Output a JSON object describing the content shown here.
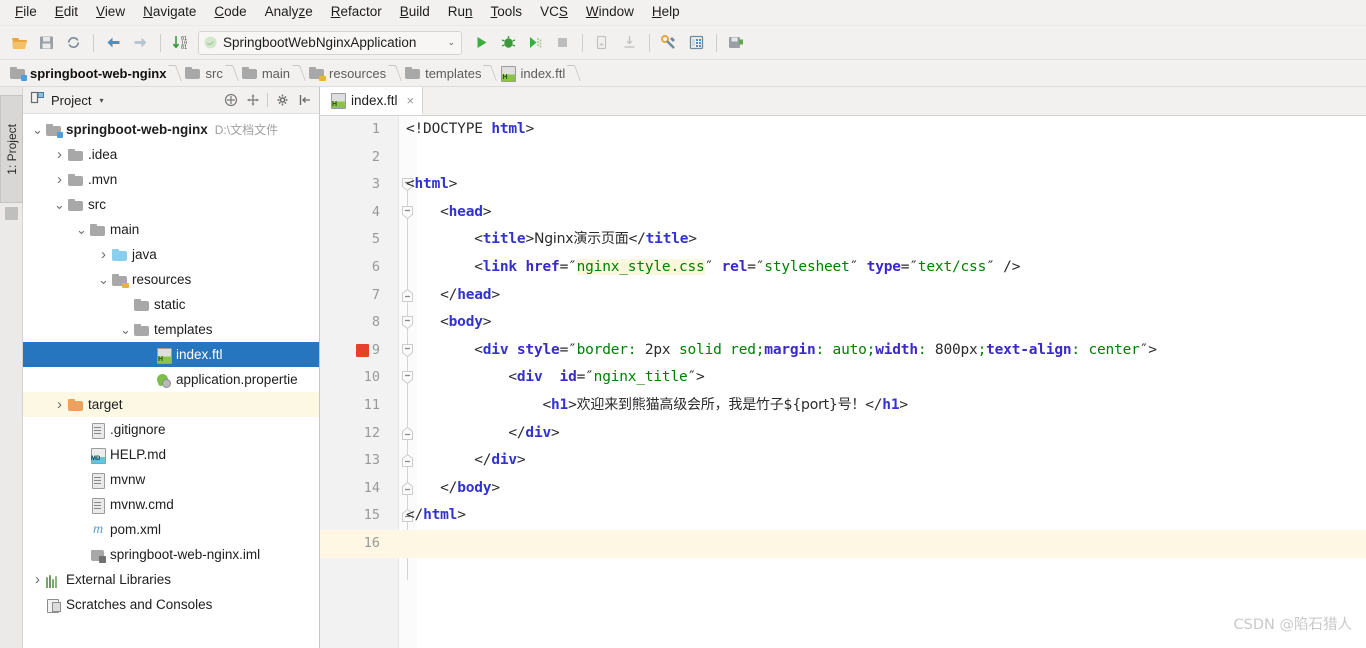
{
  "menubar": {
    "items": [
      {
        "label": "File",
        "mnemonic": "F"
      },
      {
        "label": "Edit",
        "mnemonic": "E"
      },
      {
        "label": "View",
        "mnemonic": "V"
      },
      {
        "label": "Navigate",
        "mnemonic": "N"
      },
      {
        "label": "Code",
        "mnemonic": "C"
      },
      {
        "label": "Analyze",
        "mnemonic": "z"
      },
      {
        "label": "Refactor",
        "mnemonic": "R"
      },
      {
        "label": "Build",
        "mnemonic": "B"
      },
      {
        "label": "Run",
        "mnemonic": "n"
      },
      {
        "label": "Tools",
        "mnemonic": "T"
      },
      {
        "label": "VCS",
        "mnemonic": "S"
      },
      {
        "label": "Window",
        "mnemonic": "W"
      },
      {
        "label": "Help",
        "mnemonic": "H"
      }
    ]
  },
  "toolbar": {
    "left_icons": [
      "open-folder-icon",
      "save-all-icon",
      "sync-icon"
    ],
    "nav_icons": [
      "back-arrow-icon",
      "forward-arrow-icon"
    ],
    "sort_icon": "sort-numeric-icon",
    "run_config": {
      "name": "SpringbootWebNginxApplication",
      "icon": "spring-boot-icon",
      "arrow": "⌄"
    },
    "right_icons": [
      "run-icon",
      "debug-icon",
      "run-with-coverage-icon",
      "stop-icon",
      "attach-profiler-icon",
      "attach-debugger-icon",
      "settings-wrench-icon",
      "database-icon",
      "save-deploy-icon"
    ]
  },
  "breadcrumb": {
    "items": [
      {
        "label": "springboot-web-nginx",
        "icon": "module-folder-icon"
      },
      {
        "label": "src",
        "icon": "folder-icon"
      },
      {
        "label": "main",
        "icon": "folder-icon"
      },
      {
        "label": "resources",
        "icon": "resources-folder-icon"
      },
      {
        "label": "templates",
        "icon": "folder-icon"
      },
      {
        "label": "index.ftl",
        "icon": "ftl-file-icon"
      }
    ]
  },
  "left_strip": {
    "project_tab": "1: Project",
    "structure_icon": "structure-icon"
  },
  "project_panel": {
    "title": "Project",
    "title_icon": "project-view-icon",
    "caret": "▾",
    "actions": [
      {
        "name": "collapse-all-icon"
      },
      {
        "name": "scroll-from-source-icon"
      },
      {
        "name": "settings-gear-icon"
      },
      {
        "name": "hide-panel-icon"
      }
    ],
    "tree": [
      {
        "label": "springboot-web-nginx",
        "path": "D:\\文档文件",
        "indent": 0,
        "arrow": "expanded",
        "icon": "module-folder-icon",
        "bold": true,
        "state": "normal"
      },
      {
        "label": ".idea",
        "indent": 1,
        "arrow": "collapsed",
        "icon": "folder-icon",
        "state": "normal"
      },
      {
        "label": ".mvn",
        "indent": 1,
        "arrow": "collapsed",
        "icon": "folder-icon",
        "state": "normal"
      },
      {
        "label": "src",
        "indent": 1,
        "arrow": "expanded",
        "icon": "folder-icon",
        "state": "normal"
      },
      {
        "label": "main",
        "indent": 2,
        "arrow": "expanded",
        "icon": "folder-icon",
        "state": "normal"
      },
      {
        "label": "java",
        "indent": 3,
        "arrow": "collapsed",
        "icon": "sources-folder-icon",
        "state": "normal"
      },
      {
        "label": "resources",
        "indent": 3,
        "arrow": "expanded",
        "icon": "resources-folder-icon",
        "state": "normal"
      },
      {
        "label": "static",
        "indent": 4,
        "arrow": "none",
        "icon": "folder-icon",
        "state": "normal"
      },
      {
        "label": "templates",
        "indent": 4,
        "arrow": "expanded",
        "icon": "folder-icon",
        "state": "normal"
      },
      {
        "label": "index.ftl",
        "indent": 5,
        "arrow": "none",
        "icon": "ftl-file-icon",
        "state": "selected"
      },
      {
        "label": "application.propertie",
        "indent": 5,
        "arrow": "none",
        "icon": "properties-file-icon",
        "state": "normal"
      },
      {
        "label": "target",
        "indent": 1,
        "arrow": "collapsed",
        "icon": "target-folder-icon",
        "state": "highlighted"
      },
      {
        "label": ".gitignore",
        "indent": 2,
        "arrow": "none",
        "icon": "text-file-icon",
        "state": "normal"
      },
      {
        "label": "HELP.md",
        "indent": 2,
        "arrow": "none",
        "icon": "markdown-file-icon",
        "state": "normal"
      },
      {
        "label": "mvnw",
        "indent": 2,
        "arrow": "none",
        "icon": "text-file-icon",
        "state": "normal"
      },
      {
        "label": "mvnw.cmd",
        "indent": 2,
        "arrow": "none",
        "icon": "text-file-icon",
        "state": "normal"
      },
      {
        "label": "pom.xml",
        "indent": 2,
        "arrow": "none",
        "icon": "maven-file-icon",
        "state": "normal"
      },
      {
        "label": "springboot-web-nginx.iml",
        "indent": 2,
        "arrow": "none",
        "icon": "iml-file-icon",
        "state": "normal"
      },
      {
        "label": "External Libraries",
        "indent": 0,
        "arrow": "collapsed",
        "icon": "libraries-icon",
        "state": "normal"
      },
      {
        "label": "Scratches and Consoles",
        "indent": 0,
        "arrow": "none",
        "icon": "scratches-icon",
        "state": "normal"
      }
    ]
  },
  "editor": {
    "tabs": [
      {
        "label": "index.ftl",
        "icon": "ftl-file-icon",
        "close": "×",
        "active": true
      }
    ],
    "current_line": 16,
    "breakpoint_line": 9,
    "lines": [
      {
        "n": 1,
        "fold": "none",
        "tokens": [
          {
            "t": "<!DOCTYPE ",
            "c": "plain"
          },
          {
            "t": "html",
            "c": "tagnm"
          },
          {
            "t": ">",
            "c": "tagbr"
          }
        ]
      },
      {
        "n": 2,
        "fold": "none",
        "tokens": []
      },
      {
        "n": 3,
        "fold": "open",
        "tokens": [
          {
            "t": "<",
            "c": "tagbr"
          },
          {
            "t": "html",
            "c": "tagnm"
          },
          {
            "t": ">",
            "c": "tagbr"
          }
        ]
      },
      {
        "n": 4,
        "fold": "open",
        "indent": 4,
        "tokens": [
          {
            "t": "<",
            "c": "tagbr"
          },
          {
            "t": "head",
            "c": "tagnm"
          },
          {
            "t": ">",
            "c": "tagbr"
          }
        ]
      },
      {
        "n": 5,
        "fold": "none",
        "indent": 8,
        "tokens": [
          {
            "t": "<",
            "c": "tagbr"
          },
          {
            "t": "title",
            "c": "tagnm"
          },
          {
            "t": ">",
            "c": "tagbr"
          },
          {
            "t": "Nginx演示页面",
            "c": "cn"
          },
          {
            "t": "</",
            "c": "tagbr"
          },
          {
            "t": "title",
            "c": "tagnm"
          },
          {
            "t": ">",
            "c": "tagbr"
          }
        ]
      },
      {
        "n": 6,
        "fold": "none",
        "indent": 8,
        "tokens": [
          {
            "t": "<",
            "c": "tagbr"
          },
          {
            "t": "link ",
            "c": "tagnm"
          },
          {
            "t": "href",
            "c": "attr"
          },
          {
            "t": "=″",
            "c": "eq"
          },
          {
            "t": "nginx_style.css",
            "c": "valhl"
          },
          {
            "t": "″ ",
            "c": "eq"
          },
          {
            "t": "rel",
            "c": "attr"
          },
          {
            "t": "=″",
            "c": "eq"
          },
          {
            "t": "stylesheet",
            "c": "val"
          },
          {
            "t": "″ ",
            "c": "eq"
          },
          {
            "t": "type",
            "c": "attr"
          },
          {
            "t": "=″",
            "c": "eq"
          },
          {
            "t": "text/css",
            "c": "val"
          },
          {
            "t": "″ ",
            "c": "eq"
          },
          {
            "t": "/>",
            "c": "tagbr"
          }
        ]
      },
      {
        "n": 7,
        "fold": "close",
        "indent": 4,
        "tokens": [
          {
            "t": "</",
            "c": "tagbr"
          },
          {
            "t": "head",
            "c": "tagnm"
          },
          {
            "t": ">",
            "c": "tagbr"
          }
        ]
      },
      {
        "n": 8,
        "fold": "open",
        "indent": 4,
        "tokens": [
          {
            "t": "<",
            "c": "tagbr"
          },
          {
            "t": "body",
            "c": "tagnm"
          },
          {
            "t": ">",
            "c": "tagbr"
          }
        ]
      },
      {
        "n": 9,
        "fold": "open",
        "indent": 8,
        "tokens": [
          {
            "t": "<",
            "c": "tagbr"
          },
          {
            "t": "div ",
            "c": "tagnm"
          },
          {
            "t": "style",
            "c": "attr"
          },
          {
            "t": "=″",
            "c": "eq"
          },
          {
            "t": "border: ",
            "c": "val"
          },
          {
            "t": "2px",
            "c": "num"
          },
          {
            "t": " solid red;",
            "c": "val"
          },
          {
            "t": "margin",
            "c": "attr"
          },
          {
            "t": ": auto;",
            "c": "val"
          },
          {
            "t": "width",
            "c": "attr"
          },
          {
            "t": ": ",
            "c": "val"
          },
          {
            "t": "800px",
            "c": "num"
          },
          {
            "t": ";",
            "c": "val"
          },
          {
            "t": "text-align",
            "c": "attr"
          },
          {
            "t": ": center",
            "c": "val"
          },
          {
            "t": "″",
            "c": "eq"
          },
          {
            "t": ">",
            "c": "tagbr"
          }
        ]
      },
      {
        "n": 10,
        "fold": "open",
        "indent": 12,
        "tokens": [
          {
            "t": "<",
            "c": "tagbr"
          },
          {
            "t": "div ",
            "c": "tagnm"
          },
          {
            "t": " ",
            "c": "plain"
          },
          {
            "t": "id",
            "c": "attr"
          },
          {
            "t": "=″",
            "c": "eq"
          },
          {
            "t": "nginx_title",
            "c": "val"
          },
          {
            "t": "″",
            "c": "eq"
          },
          {
            "t": ">",
            "c": "tagbr"
          }
        ]
      },
      {
        "n": 11,
        "fold": "none",
        "indent": 16,
        "tokens": [
          {
            "t": "<",
            "c": "tagbr"
          },
          {
            "t": "h1",
            "c": "tagnm"
          },
          {
            "t": ">",
            "c": "tagbr"
          },
          {
            "t": "欢迎来到熊猫高级会所，我是竹子${port}号！",
            "c": "cn"
          },
          {
            "t": "</",
            "c": "tagbr"
          },
          {
            "t": "h1",
            "c": "tagnm"
          },
          {
            "t": ">",
            "c": "tagbr"
          }
        ]
      },
      {
        "n": 12,
        "fold": "close",
        "indent": 12,
        "tokens": [
          {
            "t": "</",
            "c": "tagbr"
          },
          {
            "t": "div",
            "c": "tagnm"
          },
          {
            "t": ">",
            "c": "tagbr"
          }
        ]
      },
      {
        "n": 13,
        "fold": "close",
        "indent": 8,
        "tokens": [
          {
            "t": "</",
            "c": "tagbr"
          },
          {
            "t": "div",
            "c": "tagnm"
          },
          {
            "t": ">",
            "c": "tagbr"
          }
        ]
      },
      {
        "n": 14,
        "fold": "close",
        "indent": 4,
        "tokens": [
          {
            "t": "</",
            "c": "tagbr"
          },
          {
            "t": "body",
            "c": "tagnm"
          },
          {
            "t": ">",
            "c": "tagbr"
          }
        ]
      },
      {
        "n": 15,
        "fold": "close",
        "indent": 0,
        "tokens": [
          {
            "t": "</",
            "c": "tagbr"
          },
          {
            "t": "html",
            "c": "tagnm"
          },
          {
            "t": ">",
            "c": "tagbr"
          }
        ]
      },
      {
        "n": 16,
        "fold": "none",
        "indent": 0,
        "tokens": []
      }
    ]
  },
  "watermark": "CSDN @陷石猎人",
  "colors": {
    "selection_blue": "#2675bf",
    "breakpoint_red": "#e5412c",
    "current_line": "#fdf7e3",
    "tag_name": "#3232d0",
    "attribute": "#3a29c9",
    "string_value": "#008000",
    "toolbar_bg": "#f2f1f0"
  }
}
